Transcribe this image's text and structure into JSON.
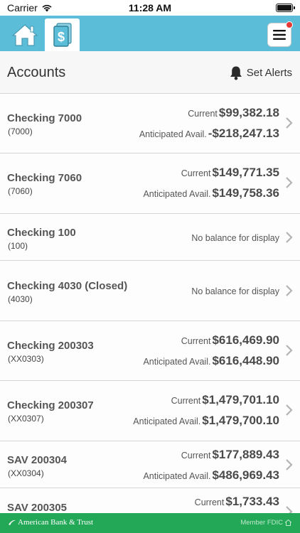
{
  "status_bar": {
    "carrier": "Carrier",
    "time": "11:28 AM"
  },
  "nav": {
    "home_icon": "home-icon",
    "accounts_icon": "dollar-document-icon",
    "menu_icon": "hamburger-menu-icon",
    "accent_color": "#5bbdd8",
    "notification_color": "#e53935"
  },
  "header": {
    "title": "Accounts",
    "set_alerts_label": "Set Alerts",
    "alerts_icon": "bell-icon"
  },
  "accounts": [
    {
      "name": "Checking 7000",
      "number": "(7000)",
      "current_label": "Current",
      "current": "$99,382.18",
      "avail_label": "Anticipated Avail.",
      "avail": "-$218,247.13"
    },
    {
      "name": "Checking 7060",
      "number": "(7060)",
      "current_label": "Current",
      "current": "$149,771.35",
      "avail_label": "Anticipated Avail.",
      "avail": "$149,758.36"
    },
    {
      "name": "Checking 100",
      "number": "(100)",
      "no_balance": "No balance for display"
    },
    {
      "name": "Checking 4030 (Closed)",
      "number": "(4030)",
      "no_balance": "No balance for display"
    },
    {
      "name": "Checking 200303",
      "number": "(XX0303)",
      "current_label": "Current",
      "current": "$616,469.90",
      "avail_label": "Anticipated Avail.",
      "avail": "$616,448.90"
    },
    {
      "name": "Checking 200307",
      "number": "(XX0307)",
      "current_label": "Current",
      "current": "$1,479,701.10",
      "avail_label": "Anticipated Avail.",
      "avail": "$1,479,700.10"
    },
    {
      "name": "SAV 200304",
      "number": "(XX0304)",
      "current_label": "Current",
      "current": "$177,889.43",
      "avail_label": "Anticipated Avail.",
      "avail": "$486,969.43"
    },
    {
      "name": "SAV 200305",
      "current_label": "Current",
      "current": "$1,733.43"
    }
  ],
  "footer": {
    "brand": "American Bank & Trust",
    "fdic": "Member FDIC",
    "color": "#23a857"
  }
}
